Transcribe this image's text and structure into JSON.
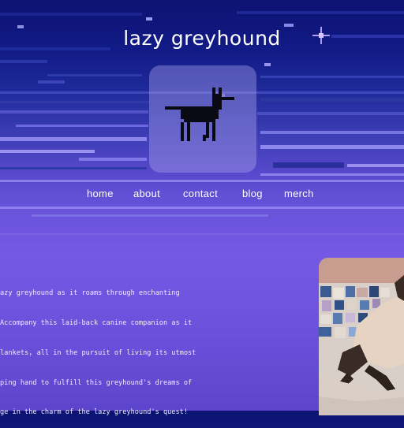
{
  "site": {
    "title": "lazy greyhound"
  },
  "logo": {
    "icon": "pixel-greyhound-icon"
  },
  "nav": {
    "items": [
      {
        "label": "home"
      },
      {
        "label": "about"
      },
      {
        "label": "contact"
      },
      {
        "label": "blog"
      },
      {
        "label": "merch"
      }
    ]
  },
  "intro": {
    "lines": [
      "azy greyhound as it roams through enchanting",
      "Accompany this laid-back canine companion as it",
      "lankets, all in the pursuit of living its utmost",
      "ping hand to fulfill this greyhound's dreams of",
      "ge in the charm of the lazy greyhound's quest!"
    ]
  },
  "photo": {
    "subject": "greyhound-in-sweater-on-quilt"
  },
  "colors": {
    "sky_top": "#0c1372",
    "sky_bottom": "#6a54dc",
    "text": "#ffffff"
  }
}
